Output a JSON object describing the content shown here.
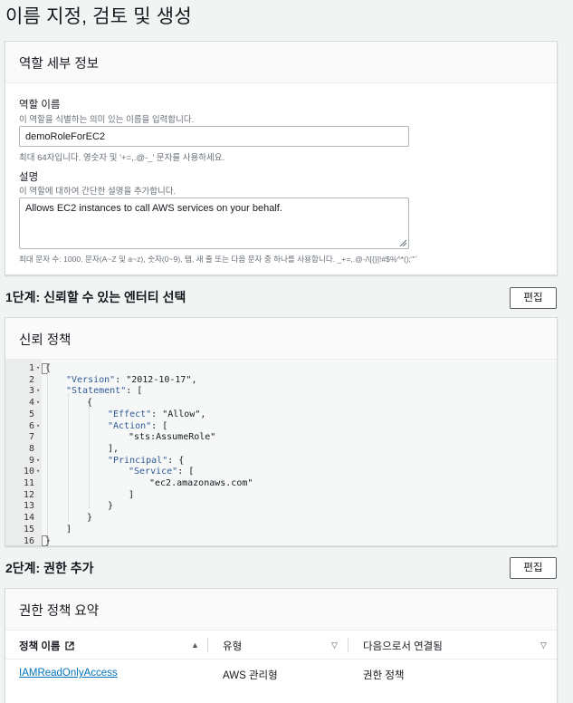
{
  "page": {
    "title": "이름 지정, 검토 및 생성"
  },
  "role_details": {
    "header": "역할 세부 정보",
    "name_label": "역할 이름",
    "name_desc": "이 역할을 식별하는 의미 있는 이름을 입력합니다.",
    "name_value": "demoRoleForEC2",
    "name_hint": "최대 64자입니다. 영숫자 및 '+=,.@-_' 문자를 사용하세요.",
    "desc_label": "설명",
    "desc_desc": "이 역할에 대하여 간단한 설명을 추가합니다.",
    "desc_value": "Allows EC2 instances to call AWS services on your behalf.",
    "desc_hint": "최대 문자 수: 1000. 문자(A~Z 및 a~z), 숫자(0~9), 탭, 새 줄 또는 다음 문자 중 하나를 사용합니다. _+=,.@-/\\[{}]!#$%^*();\"'`"
  },
  "step1": {
    "title": "1단계: 신뢰할 수 있는 엔터티 선택",
    "edit_label": "편집",
    "card_header": "신뢰 정책",
    "code_lines": [
      {
        "n": "1",
        "fold": true,
        "indent": 0,
        "text": "{"
      },
      {
        "n": "2",
        "fold": false,
        "indent": 1,
        "key": "\"Version\"",
        "rest": ": \"2012-10-17\","
      },
      {
        "n": "3",
        "fold": true,
        "indent": 1,
        "key": "\"Statement\"",
        "rest": ": ["
      },
      {
        "n": "4",
        "fold": true,
        "indent": 2,
        "text": "{"
      },
      {
        "n": "5",
        "fold": false,
        "indent": 3,
        "key": "\"Effect\"",
        "rest": ": \"Allow\","
      },
      {
        "n": "6",
        "fold": true,
        "indent": 3,
        "key": "\"Action\"",
        "rest": ": ["
      },
      {
        "n": "7",
        "fold": false,
        "indent": 4,
        "text": "\"sts:AssumeRole\""
      },
      {
        "n": "8",
        "fold": false,
        "indent": 3,
        "text": "],"
      },
      {
        "n": "9",
        "fold": true,
        "indent": 3,
        "key": "\"Principal\"",
        "rest": ": {"
      },
      {
        "n": "10",
        "fold": true,
        "indent": 4,
        "key": "\"Service\"",
        "rest": ": ["
      },
      {
        "n": "11",
        "fold": false,
        "indent": 5,
        "text": "\"ec2.amazonaws.com\""
      },
      {
        "n": "12",
        "fold": false,
        "indent": 4,
        "text": "]"
      },
      {
        "n": "13",
        "fold": false,
        "indent": 3,
        "text": "}"
      },
      {
        "n": "14",
        "fold": false,
        "indent": 2,
        "text": "}"
      },
      {
        "n": "15",
        "fold": false,
        "indent": 1,
        "text": "]"
      },
      {
        "n": "16",
        "fold": false,
        "indent": 0,
        "text": "}"
      }
    ]
  },
  "step2": {
    "title": "2단계: 권한 추가",
    "edit_label": "편집",
    "card_header": "권한 정책 요약",
    "columns": [
      "정책 이름",
      "유형",
      "다음으로서 연결됨"
    ],
    "rows": [
      {
        "name": "IAMReadOnlyAccess",
        "type": "AWS 관리형",
        "attached_as": "권한 정책"
      }
    ]
  }
}
